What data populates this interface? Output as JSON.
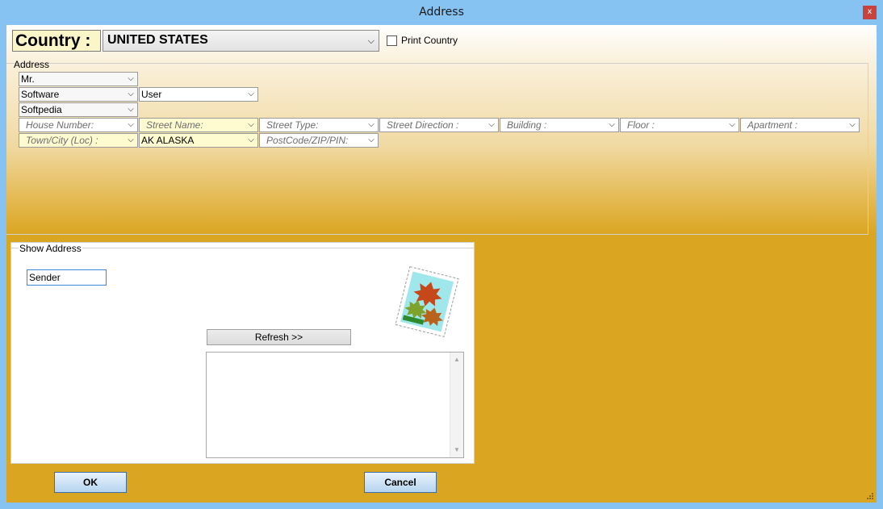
{
  "window": {
    "title": "Address",
    "close_glyph": "x"
  },
  "country": {
    "label": "Country :",
    "value": "UNITED STATES"
  },
  "print_country": {
    "label": "Print Country",
    "checked": false
  },
  "address": {
    "legend": "Address",
    "title": "Mr.",
    "first_name": "Software",
    "last_name": "User",
    "company": "Softpedia",
    "house_number": "House Number:",
    "street_name": "Street Name:",
    "street_type": "Street Type:",
    "street_direction": "Street Direction :",
    "building": "Building :",
    "floor": "Floor :",
    "apartment": "Apartment :",
    "town_city": "Town/City (Loc) :",
    "state": "AK ALASKA",
    "postcode": "PostCode/ZIP/PIN:"
  },
  "show_address": {
    "legend": "Show Address",
    "sender_value": "Sender",
    "refresh_label": "Refresh >>",
    "result_text": ""
  },
  "buttons": {
    "ok": "OK",
    "cancel": "Cancel"
  },
  "icons": {
    "close": "close-icon",
    "dropdown": "chevron-down-icon",
    "stamp": "stamp-logo-icon",
    "grip": "resize-grip-icon"
  },
  "colors": {
    "titlebar": "#86c2f2",
    "body_gold": "#daa520",
    "close_red": "#c9433c",
    "country_label_bg": "#fbf6c8",
    "button_blue": "#b6d4ef"
  }
}
